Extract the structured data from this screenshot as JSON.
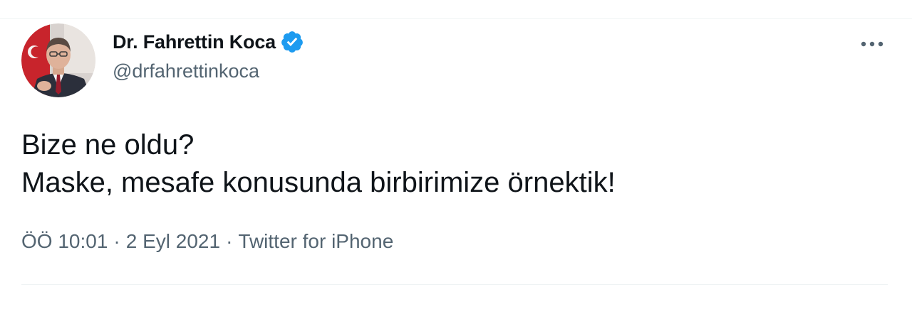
{
  "tweet": {
    "author": {
      "display_name": "Dr. Fahrettin Koca",
      "handle": "@drfahrettinkoca",
      "verified": true,
      "verified_color": "#1d9bf0"
    },
    "text": "Bize ne oldu?\nMaske, mesafe konusunda birbirimize örnektik!",
    "time": "ÖÖ 10:01",
    "date": "2 Eyl 2021",
    "source": "Twitter for iPhone",
    "separator": "·"
  },
  "icons": {
    "more": "more-horizontal-icon",
    "verified": "verified-badge-icon"
  },
  "colors": {
    "text_primary": "#0f1419",
    "text_secondary": "#536471",
    "divider": "#eff3f4"
  }
}
